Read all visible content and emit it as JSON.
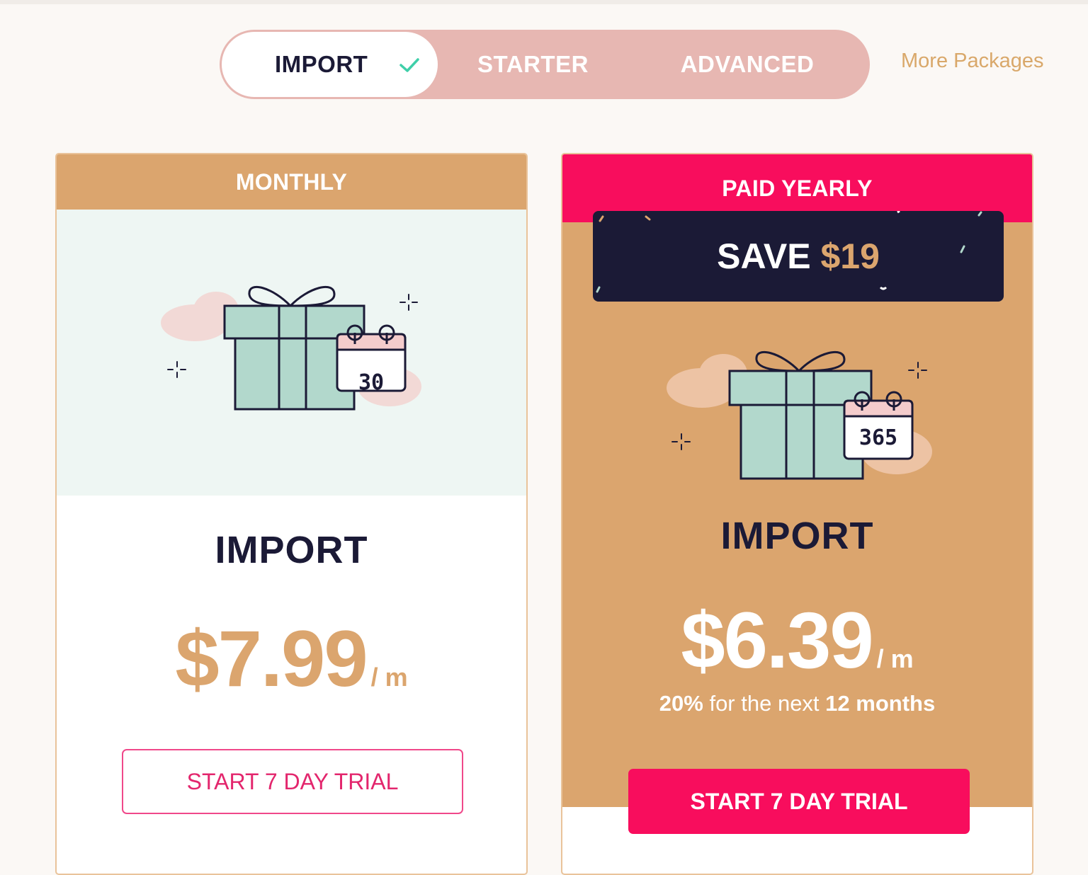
{
  "tabs": {
    "items": [
      {
        "label": "IMPORT",
        "active": true
      },
      {
        "label": "STARTER",
        "active": false
      },
      {
        "label": "ADVANCED",
        "active": false
      }
    ],
    "more_link": "More Packages"
  },
  "cards": {
    "monthly": {
      "band": "MONTHLY",
      "calendar_number": "30",
      "plan": "IMPORT",
      "price": "$7.99",
      "per": "/ m",
      "button": "START 7 DAY TRIAL"
    },
    "yearly": {
      "band": "PAID YEARLY",
      "save_label": "SAVE",
      "save_amount": "$19",
      "calendar_number": "365",
      "plan": "IMPORT",
      "price": "$6.39",
      "per": "/ m",
      "note_percent": "20%",
      "note_middle": " for the next ",
      "note_period": "12 months",
      "button": "START 7 DAY TRIAL"
    }
  },
  "colors": {
    "accent_gold": "#dba56e",
    "accent_pink": "#f80d5d",
    "navy": "#1b1a36",
    "tab_bg": "#e7b7b2",
    "mint": "#b2d8cc"
  },
  "icons": [
    "check-icon",
    "gift-icon",
    "calendar-icon",
    "sparkle-icon",
    "cloud-icon",
    "confetti-icon"
  ]
}
